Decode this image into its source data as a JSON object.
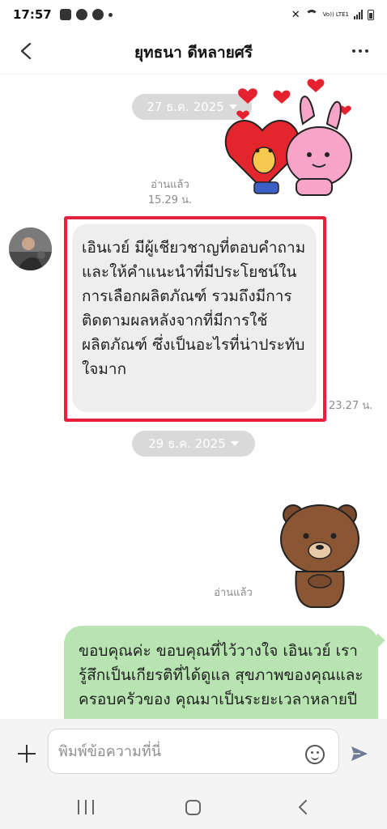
{
  "status_bar": {
    "time": "17:57",
    "volte_label": "Vo)) LTE1"
  },
  "header": {
    "title": "ยุทธนา ดีหลายศรี"
  },
  "chat": {
    "date_1": "27 ธ.ค. 2025",
    "read_label_1": "อ่านแล้ว",
    "read_time_1": "15.29 น.",
    "received_message": "เอินเวย์ มีผู้เชียวชาญที่ตอบคำถาม และให้คำแนะนำที่มีประโยชน์ในการเลือกผลิตภัณฑ์ รวมถึงมีการติดตามผลหลังจากที่มีการใช้ผลิตภัณฑ์ ซึ่งเป็นอะไรที่น่าประทับใจมาก",
    "received_time": "23.27 น.",
    "date_2": "29 ธ.ค. 2025",
    "read_label_2": "อ่านแล้ว",
    "sent_message": "ขอบคุณค่ะ ขอบคุณที่ไว้วางใจ เอินเวย์ เรารู้สึกเป็นเกียรติที่ได้ดูแล สุขภาพของคุณและครอบครัวของ คุณมาเป็นระยะเวลาหลายปี การ"
  },
  "input": {
    "placeholder": "พิมพ์ข้อความที่นี่"
  },
  "colors": {
    "highlight": "#e5213d",
    "sent_bubble": "#b7e4b1",
    "received_bubble": "#eeeeee",
    "date_chip": "#d9d9d9"
  },
  "icons": {
    "back": "chevron-left-icon",
    "more": "more-dots-icon",
    "add": "plus-icon",
    "emoji": "emoji-icon",
    "send": "send-icon"
  }
}
